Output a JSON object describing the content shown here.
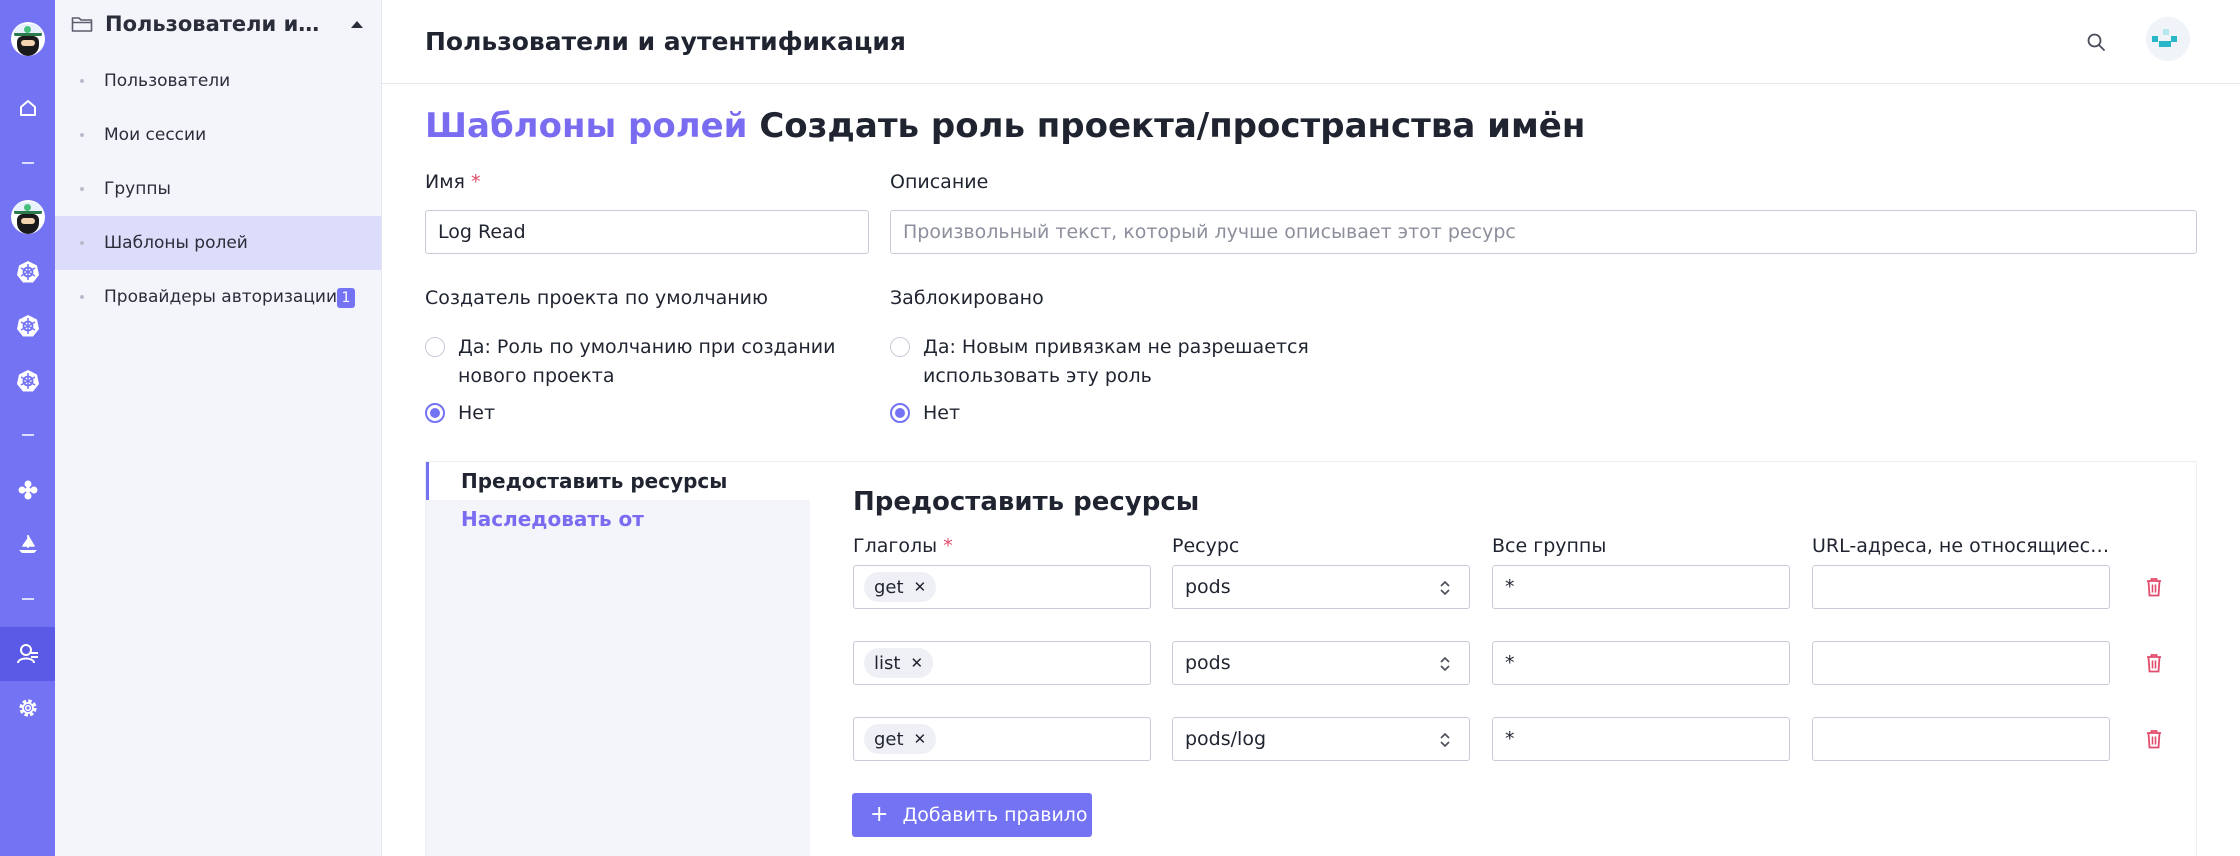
{
  "sidebar": {
    "title": "Пользователи и аутентификация",
    "items": [
      {
        "label": "Пользователи"
      },
      {
        "label": "Мои сессии"
      },
      {
        "label": "Группы"
      },
      {
        "label": "Шаблоны ролей"
      },
      {
        "label": "Провайдеры авторизации",
        "badge": "1"
      }
    ]
  },
  "header": {
    "title": "Пользователи и аутентификация"
  },
  "page": {
    "breadcrumb": "Шаблоны ролей",
    "title": "Создать роль проекта/пространства имён"
  },
  "form": {
    "name_label": "Имя",
    "required_mark": "*",
    "name_value": "Log Read",
    "description_label": "Описание",
    "description_placeholder": "Произвольный текст, который лучше описывает этот ресурс",
    "project_creator_default_label": "Создатель проекта по умолчанию",
    "project_creator_yes": "Да: Роль по умолчанию при создании нового проекта",
    "project_creator_no": "Нет",
    "project_creator_selected": "no",
    "locked_label": "Заблокировано",
    "locked_yes": "Да: Новым привязкам не разрешается использовать эту роль",
    "locked_no": "Нет",
    "locked_selected": "no"
  },
  "tabs": [
    {
      "label": "Предоставить ресурсы",
      "active": true
    },
    {
      "label": "Наследовать от",
      "active": false
    }
  ],
  "rules": {
    "section_title": "Предоставить ресурсы",
    "columns": {
      "verbs": "Глаголы",
      "resource": "Ресурс",
      "api_groups": "Все группы",
      "non_resource_urls": "URL-адреса, не относящиеся к ресурсам"
    },
    "rows": [
      {
        "verb": "get",
        "resource": "pods",
        "api_group": "*",
        "non_resource_url": ""
      },
      {
        "verb": "list",
        "resource": "pods",
        "api_group": "*",
        "non_resource_url": ""
      },
      {
        "verb": "get",
        "resource": "pods/log",
        "api_group": "*",
        "non_resource_url": ""
      }
    ],
    "add_rule_label": "Добавить правило"
  },
  "colors": {
    "accent": "#7373f4",
    "accent_text": "#7a6cf0",
    "danger": "#e24c6b",
    "rail_active": "#5a5ae6"
  }
}
